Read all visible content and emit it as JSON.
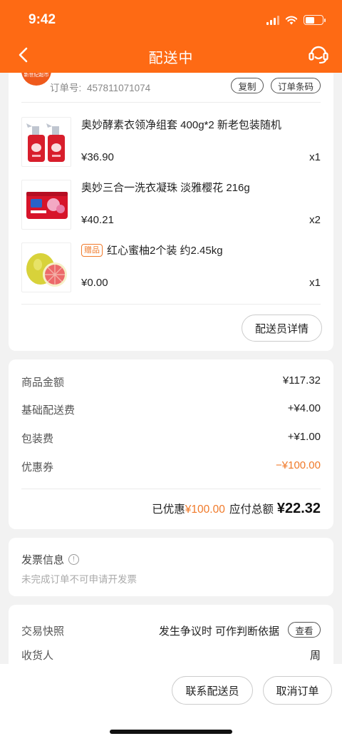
{
  "status_bar": {
    "time": "9:42"
  },
  "header": {
    "title": "配送中",
    "accent_color": "#fe6a14"
  },
  "order": {
    "store_logo_text": "新世纪超市",
    "order_no_label": "订单号:",
    "order_no": "457811071074",
    "copy_label": "复制",
    "barcode_label": "订单条码",
    "items": [
      {
        "name": "奥妙酵素衣领净组套 400g*2 新老包装随机",
        "price": "¥36.90",
        "qty": "x1",
        "gift": false,
        "icon": "detergent-spray-bottles"
      },
      {
        "name": "奥妙三合一洗衣凝珠 淡雅樱花 216g",
        "price": "¥40.21",
        "qty": "x2",
        "gift": false,
        "icon": "laundry-pods-tub"
      },
      {
        "name": "红心蜜柚2个装 约2.45kg",
        "price": "¥0.00",
        "qty": "x1",
        "gift": true,
        "gift_label": "赠品",
        "icon": "pomelo-fruit"
      }
    ],
    "courier_detail_label": "配送员详情"
  },
  "summary": {
    "rows": [
      {
        "label": "商品金额",
        "value": "¥117.32"
      },
      {
        "label": "基础配送费",
        "value": "+¥4.00"
      },
      {
        "label": "包装费",
        "value": "+¥1.00"
      },
      {
        "label": "优惠券",
        "value": "−¥100.00"
      }
    ],
    "discount_prefix": "已优惠",
    "discount_amount": "¥100.00",
    "total_label": "应付总额",
    "total_amount": "¥22.32",
    "discount_color": "#f07a2a"
  },
  "invoice": {
    "title": "发票信息",
    "info_icon": "!",
    "subtitle": "未完成订单不可申请开发票"
  },
  "snapshot": {
    "label": "交易快照",
    "description": "发生争议时 可作判断依据",
    "view_label": "查看",
    "receiver_label": "收货人",
    "receiver_value": "周"
  },
  "bottom": {
    "contact_courier_label": "联系配送员",
    "cancel_order_label": "取消订单"
  }
}
